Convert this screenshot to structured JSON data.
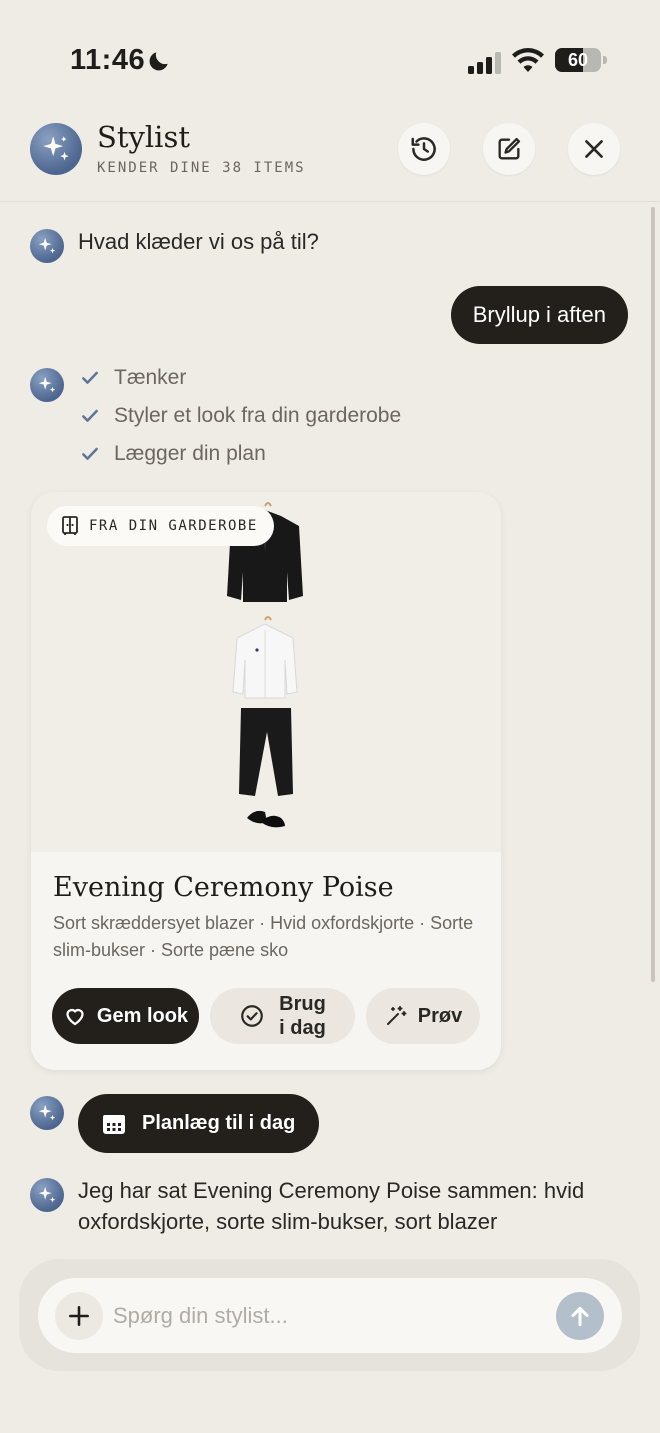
{
  "status_bar": {
    "time": "11:46",
    "battery": "60",
    "battery_level": 0.6
  },
  "header": {
    "title": "Stylist",
    "subtitle": "KENDER DINE 38 ITEMS",
    "icons": [
      "sparkles-icon",
      "history-icon",
      "edit-icon",
      "close-icon"
    ]
  },
  "chat": {
    "assistant_greeting": "Hvad klæder vi os på til?",
    "user_message": "Bryllup i aften",
    "steps": [
      {
        "label": "Tænker"
      },
      {
        "label": "Styler et look fra din garderobe"
      },
      {
        "label": "Lægger din plan"
      }
    ],
    "outfit_card": {
      "badge": "FRA DIN GARDEROBE",
      "title": "Evening Ceremony Poise",
      "items_text": "Sort skræddersyet blazer · Hvid oxfordskjorte · Sorte slim-bukser · Sorte pæne sko",
      "save_label": "Gem look",
      "wear_label_line1": "Brug",
      "wear_label_line2": "i dag",
      "try_label": "Prøv"
    },
    "plan_button": "Planlæg til i dag",
    "summary": "Jeg har sat Evening Ceremony Poise sammen: hvid oxfordskjorte, sorte slim-bukser, sort blazer"
  },
  "composer": {
    "placeholder": "Spørg din stylist..."
  },
  "colors": {
    "background": "#efece6",
    "dark": "#23201c",
    "accent": "#4d6690",
    "check": "#5f7597"
  }
}
